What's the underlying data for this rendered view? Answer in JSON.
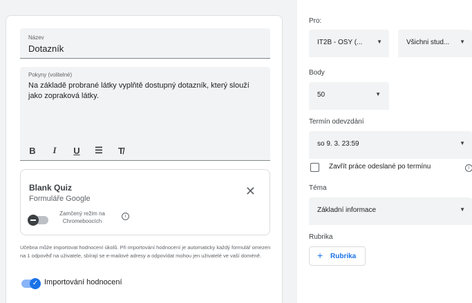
{
  "assignment": {
    "title_label": "Název",
    "title_value": "Dotazník",
    "instructions_label": "Pokyny (volitelné)",
    "instructions_value": "Na základě probrané látky vyplňtě dostupný dotazník, který slouží jako zopraková látky.",
    "format": {
      "bold": "B",
      "italic": "I",
      "underline": "U",
      "list": "☰",
      "clear": "T̸"
    }
  },
  "attachment": {
    "title": "Blank Quiz",
    "subtitle": "Formuláře Google",
    "close": "✕",
    "lock_label": "Zamčený režim na Chromeboocích",
    "info": "i"
  },
  "note": "Učebna může importovat hodnocení úkolů. Při importování hodnocení je automaticky každý formulář omezen na 1 odpověď na uživatele, sbírají se e-mailové adresy a odpovídat mohou jen uživatelé ve vaší doméně.",
  "import_grades": {
    "label": "Importování hodnocení",
    "check": "✓",
    "enabled": true
  },
  "sidebar": {
    "for_label": "Pro:",
    "class_value": "IT2B - OSY (...",
    "students_value": "Všichni stud...",
    "points_label": "Body",
    "points_value": "50",
    "due_label": "Termín odevzdání",
    "due_value": "so 9. 3. 23:59",
    "close_late_label": "Zavřít práce odeslané po termínu",
    "topic_label": "Téma",
    "topic_value": "Základní informace",
    "rubric_label": "Rubrika",
    "rubric_button_plus": "+",
    "rubric_button": "Rubrika",
    "arrow": "▼",
    "info": "i"
  },
  "colors": {
    "accent": "#1a73e8",
    "field_bg": "#f1f3f4"
  },
  "icons": [
    "bold-icon",
    "italic-icon",
    "underline-icon",
    "list-icon",
    "clear-format-icon",
    "close-icon",
    "info-icon",
    "check-icon",
    "dropdown-arrow-icon",
    "plus-icon"
  ]
}
